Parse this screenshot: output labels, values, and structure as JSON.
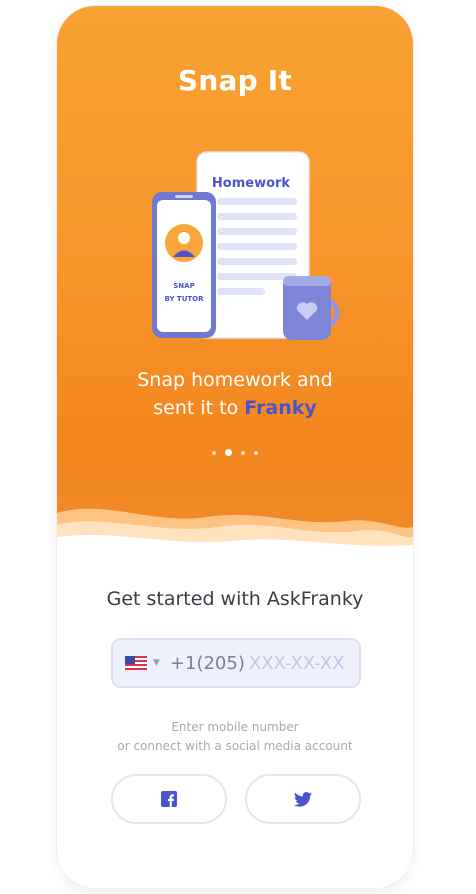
{
  "hero": {
    "title": "Snap It",
    "illustration": {
      "document_title": "Homework",
      "phone_label_line1": "SNAP",
      "phone_label_line2": "BY TUTOR"
    },
    "caption_line1": "Snap homework  and",
    "caption_line2_prefix": "sent it to ",
    "caption_line2_accent": "Franky",
    "pagination": {
      "total": 4,
      "active_index": 1
    }
  },
  "signup": {
    "heading": "Get started with AskFranky",
    "phone": {
      "country_flag": "us-flag-icon",
      "country_code": "+1(205)",
      "placeholder": "XXX-XX-XX",
      "value": ""
    },
    "hint_line1": "Enter mobile number",
    "hint_line2": "or connect with a social media account",
    "social": [
      {
        "icon": "facebook-icon"
      },
      {
        "icon": "twitter-icon"
      }
    ]
  },
  "colors": {
    "orange_top": "#f8a233",
    "orange_bottom": "#f4871f",
    "accent_blue": "#4b55c9",
    "field_bg": "#eef0fb",
    "field_border": "#dde0f4"
  }
}
